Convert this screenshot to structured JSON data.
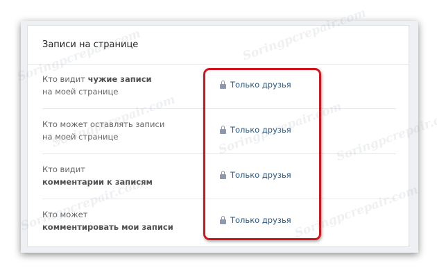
{
  "section": {
    "title": "Записи на странице"
  },
  "rows": [
    {
      "label_line1_pre": "Кто видит ",
      "label_line1_bold": "чужие записи",
      "label_line2_pre": "на моей странице",
      "label_line2_bold": "",
      "value": "Только друзья"
    },
    {
      "label_line1_pre": "Кто может оставлять записи",
      "label_line1_bold": "",
      "label_line2_pre": "на моей странице",
      "label_line2_bold": "",
      "value": "Только друзья"
    },
    {
      "label_line1_pre": "Кто видит",
      "label_line1_bold": "",
      "label_line2_pre": "",
      "label_line2_bold": "комментарии к записям",
      "value": "Только друзья"
    },
    {
      "label_line1_pre": "Кто может",
      "label_line1_bold": "",
      "label_line2_pre": "",
      "label_line2_bold": "комментировать мои записи",
      "value": "Только друзья"
    }
  ],
  "watermark": "Soringpcrepair.com",
  "icons": {
    "value_prefix": "lock-icon"
  },
  "colors": {
    "link": "#2a5885",
    "lock": "#8b9aae",
    "highlight": "#d1131b"
  }
}
